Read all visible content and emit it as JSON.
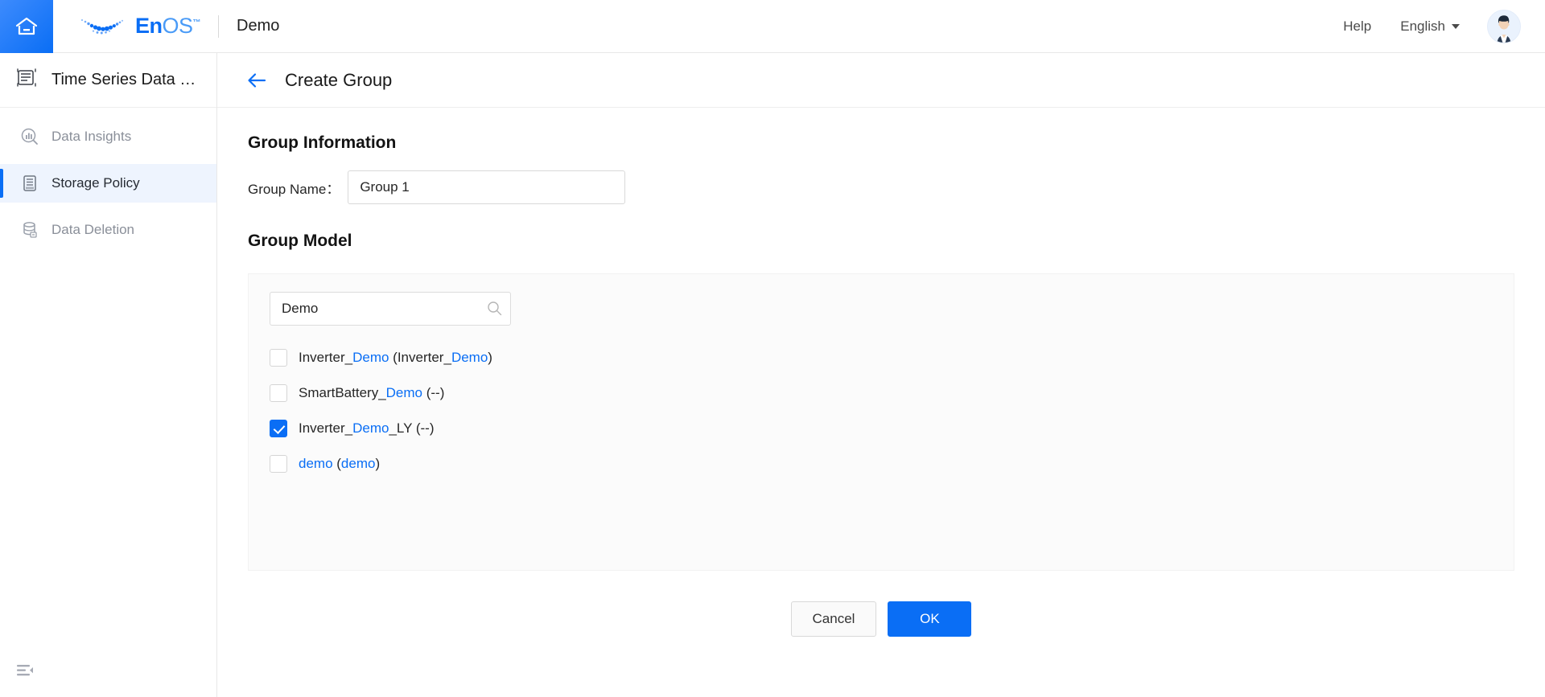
{
  "header": {
    "home_icon": "home-icon",
    "brand": {
      "en": "En",
      "os": "OS",
      "tm": "™"
    },
    "tenant": "Demo",
    "help_label": "Help",
    "language_label": "English",
    "avatar_icon": "user-avatar"
  },
  "sidebar": {
    "app_title": "Time Series Data …",
    "app_icon": "time-series-icon",
    "items": [
      {
        "label": "Data Insights",
        "icon": "data-insights-icon",
        "active": false
      },
      {
        "label": "Storage Policy",
        "icon": "storage-policy-icon",
        "active": true
      },
      {
        "label": "Data Deletion",
        "icon": "data-deletion-icon",
        "active": false
      }
    ],
    "collapse_icon": "collapse-sidebar-icon"
  },
  "page": {
    "back_icon": "back-arrow-icon",
    "title": "Create Group",
    "group_information_title": "Group Information",
    "group_name_label": "Group Name：",
    "group_name_value": "Group 1",
    "group_name_placeholder": "",
    "group_model_title": "Group Model",
    "search": {
      "value": "Demo",
      "placeholder": "",
      "icon": "search-icon"
    },
    "models": [
      {
        "checked": false,
        "parts": [
          {
            "t": "Inverter_",
            "hl": false
          },
          {
            "t": "Demo",
            "hl": true
          },
          {
            "t": " (Inverter_",
            "hl": false
          },
          {
            "t": "Demo",
            "hl": true
          },
          {
            "t": ")",
            "hl": false
          }
        ],
        "plain": "Inverter_Demo (Inverter_Demo)"
      },
      {
        "checked": false,
        "parts": [
          {
            "t": "SmartBattery_",
            "hl": false
          },
          {
            "t": "Demo",
            "hl": true
          },
          {
            "t": " (--)",
            "hl": false
          }
        ],
        "plain": "SmartBattery_Demo (--)"
      },
      {
        "checked": true,
        "parts": [
          {
            "t": "Inverter_",
            "hl": false
          },
          {
            "t": "Demo",
            "hl": true
          },
          {
            "t": "_LY (--)",
            "hl": false
          }
        ],
        "plain": "Inverter_Demo_LY (--)"
      },
      {
        "checked": false,
        "parts": [
          {
            "t": "demo",
            "hl": true
          },
          {
            "t": " (",
            "hl": false
          },
          {
            "t": "demo",
            "hl": true
          },
          {
            "t": ")",
            "hl": false
          }
        ],
        "plain": "demo (demo)"
      }
    ],
    "cancel_label": "Cancel",
    "ok_label": "OK"
  },
  "colors": {
    "accent": "#0a6ef5",
    "active_bg": "#eef4fe",
    "panel_bg": "#fbfbfb",
    "muted_text": "#8a8f99"
  }
}
